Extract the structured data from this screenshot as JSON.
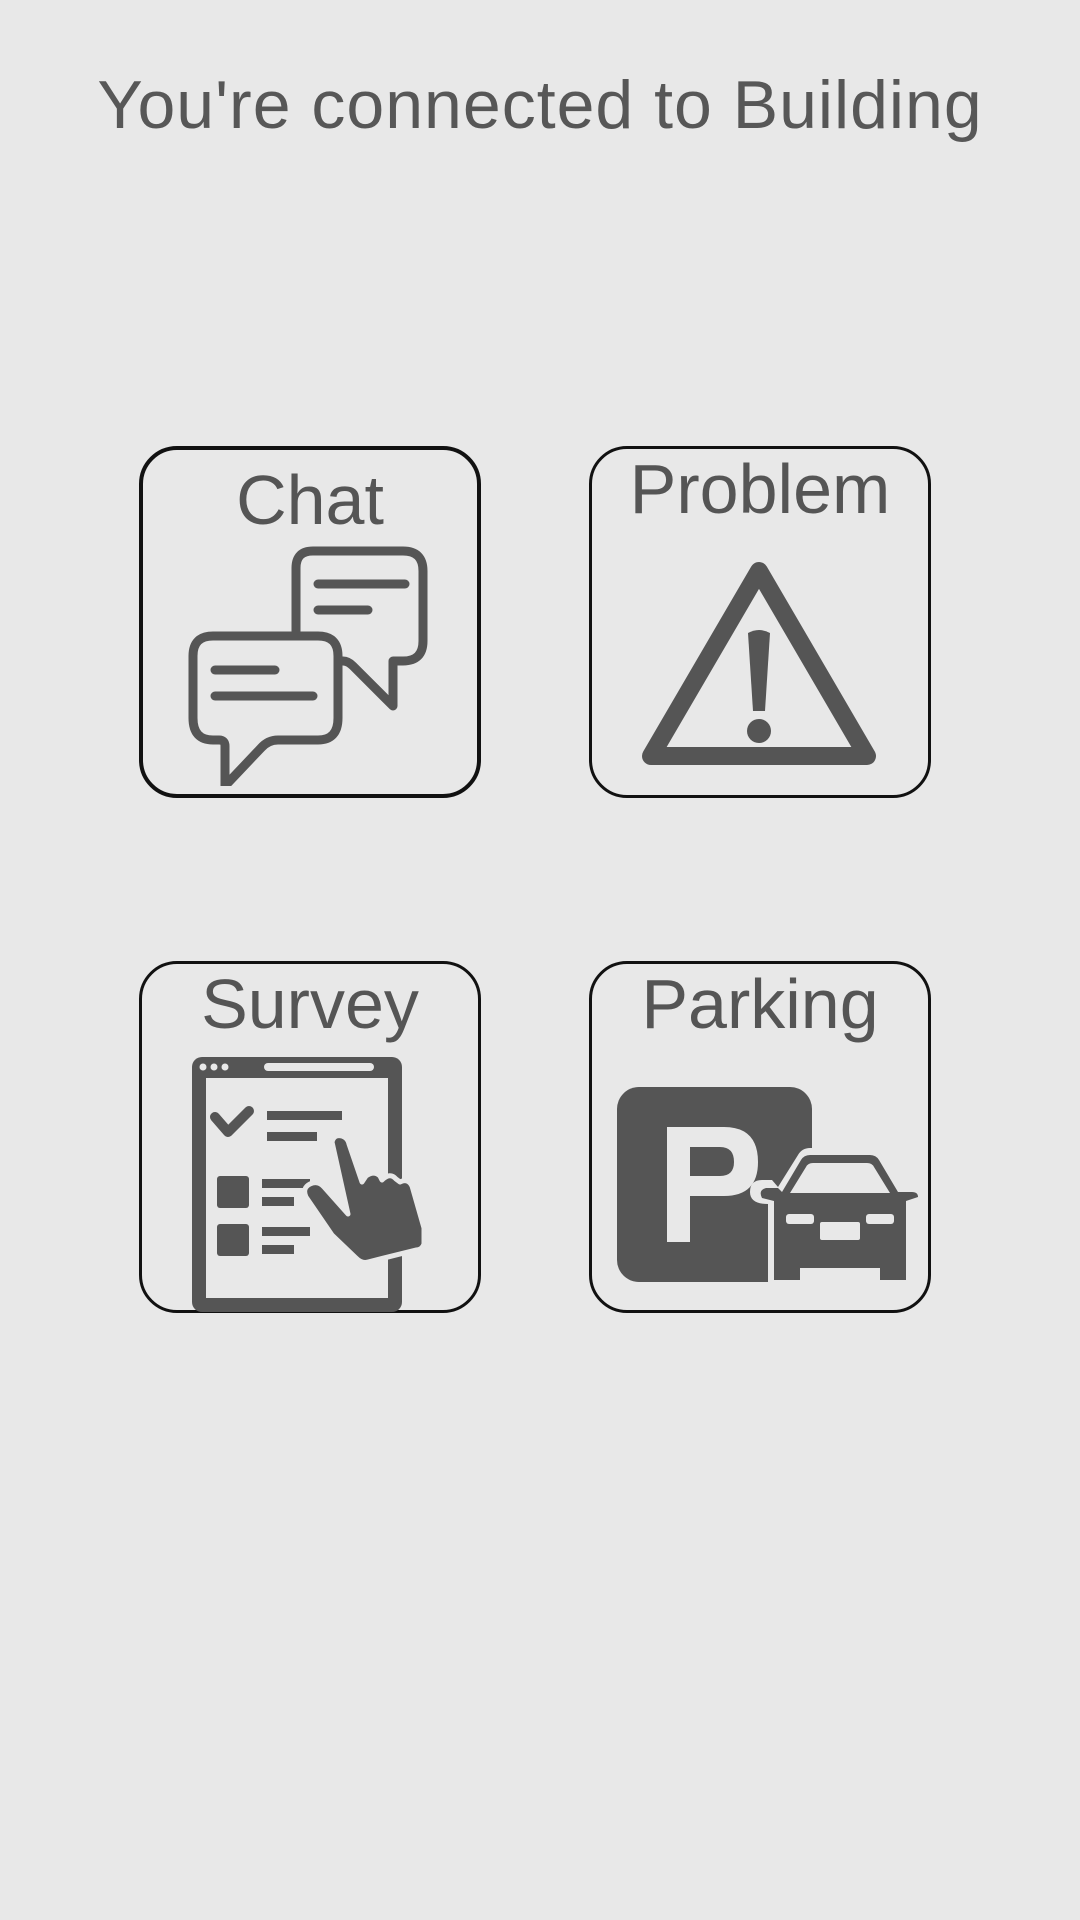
{
  "header": {
    "title": "You're connected to Building"
  },
  "tiles": [
    {
      "label": "Chat",
      "icon": "chat-bubbles-icon"
    },
    {
      "label": "Problem",
      "icon": "warning-icon"
    },
    {
      "label": "Survey",
      "icon": "survey-form-icon"
    },
    {
      "label": "Parking",
      "icon": "parking-car-icon"
    }
  ],
  "colors": {
    "background": "#e8e8e8",
    "icon": "#555555",
    "text": "#555555",
    "tile_border": "#111111"
  }
}
